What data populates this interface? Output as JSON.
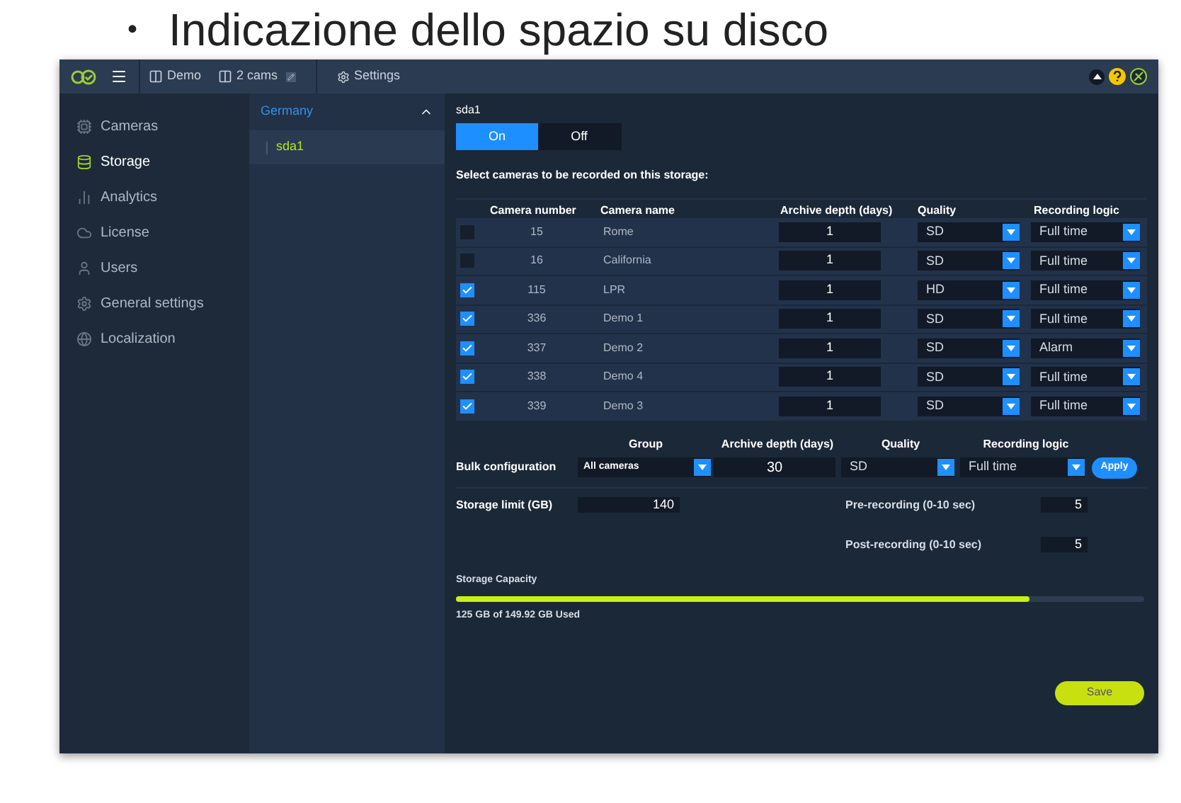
{
  "slide_title": {
    "bullet": "•",
    "text": "Indicazione dello spazio su disco"
  },
  "toolbar": {
    "items": [
      {
        "kind": "layout",
        "label": "Demo",
        "editable": false
      },
      {
        "kind": "layout",
        "label": "2 cams",
        "editable": true
      },
      {
        "kind": "settings",
        "label": "Settings",
        "editable": false
      }
    ]
  },
  "sidebar": {
    "items": [
      {
        "label": "Cameras",
        "selected": false
      },
      {
        "label": "Storage",
        "selected": true
      },
      {
        "label": "Analytics",
        "selected": false
      },
      {
        "label": "License",
        "selected": false
      },
      {
        "label": "Users",
        "selected": false
      },
      {
        "label": "General settings",
        "selected": false
      },
      {
        "label": "Localization",
        "selected": false
      }
    ]
  },
  "tree": {
    "label": "Germany",
    "expanded": true,
    "children": [
      {
        "label": "sda1",
        "selected": true
      }
    ]
  },
  "storage": {
    "title": "sda1",
    "toggle": [
      {
        "label": "On",
        "selected": true
      },
      {
        "label": "Off",
        "selected": false
      }
    ],
    "caption": "Select cameras to be recorded on this storage:",
    "columns": [
      "Camera number",
      "Camera name",
      "Archive depth (days)",
      "Quality",
      "Recording logic"
    ],
    "rows": [
      {
        "checked": false,
        "number": "15",
        "name": "Rome",
        "depth": "1",
        "quality": "SD",
        "logic": "Full time"
      },
      {
        "checked": false,
        "number": "16",
        "name": "California",
        "depth": "1",
        "quality": "SD",
        "logic": "Full time"
      },
      {
        "checked": true,
        "number": "115",
        "name": "LPR",
        "depth": "1",
        "quality": "HD",
        "logic": "Full time"
      },
      {
        "checked": true,
        "number": "336",
        "name": "Demo 1",
        "depth": "1",
        "quality": "SD",
        "logic": "Full time"
      },
      {
        "checked": true,
        "number": "337",
        "name": "Demo 2",
        "depth": "1",
        "quality": "SD",
        "logic": "Alarm"
      },
      {
        "checked": true,
        "number": "338",
        "name": "Demo 4",
        "depth": "1",
        "quality": "SD",
        "logic": "Full time"
      },
      {
        "checked": true,
        "number": "339",
        "name": "Demo 3",
        "depth": "1",
        "quality": "SD",
        "logic": "Full time"
      }
    ]
  },
  "bulk": {
    "label": "Bulk configuration",
    "headers": [
      "Group",
      "Archive depth (days)",
      "Quality",
      "Recording logic"
    ],
    "group": "All cameras",
    "depth": "30",
    "quality": "SD",
    "logic": "Full time",
    "apply": "Apply"
  },
  "storage_limit": {
    "label": "Storage limit (GB)",
    "value": "140"
  },
  "pre_recording": {
    "label": "Pre-recording (0-10 sec)",
    "value": "5"
  },
  "post_recording": {
    "label": "Post-recording (0-10 sec)",
    "value": "5"
  },
  "capacity": {
    "label": "Storage Capacity",
    "level": 0.834,
    "reading": "125 GB of 149.92 GB Used"
  },
  "save": "Save"
}
